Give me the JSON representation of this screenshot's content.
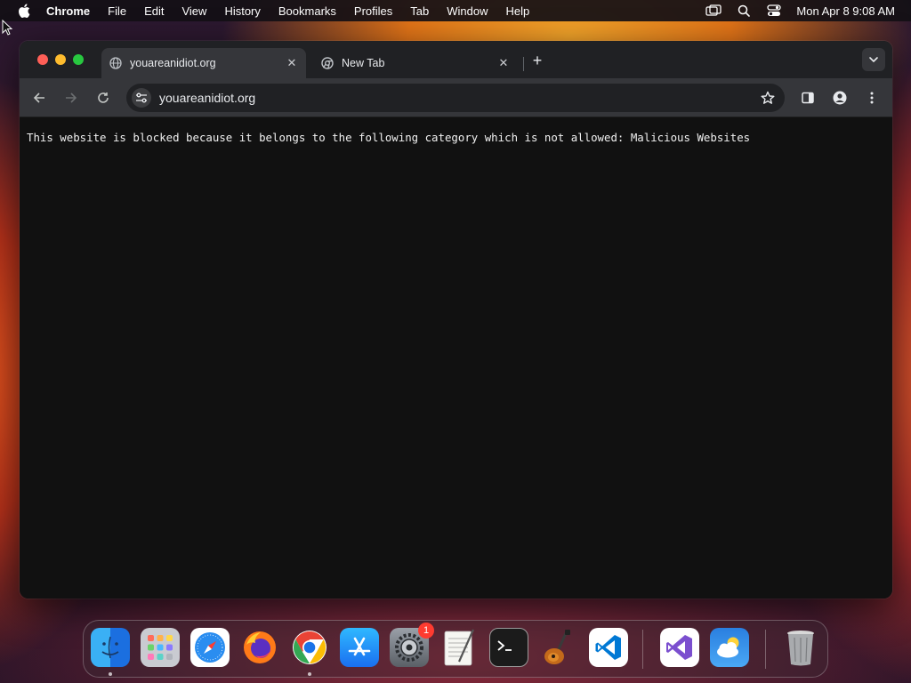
{
  "menubar": {
    "app_name": "Chrome",
    "items": [
      "File",
      "Edit",
      "View",
      "History",
      "Bookmarks",
      "Profiles",
      "Tab",
      "Window",
      "Help"
    ],
    "clock": "Mon Apr 8  9:08 AM",
    "status_icons": [
      "screen-mirroring-icon",
      "spotlight-search-icon",
      "control-center-icon"
    ]
  },
  "browser": {
    "tabs": [
      {
        "title": "youareanidiot.org",
        "favicon": "globe-icon",
        "active": true
      },
      {
        "title": "New Tab",
        "favicon": "chrome-icon",
        "active": false
      }
    ],
    "url": "youareanidiot.org",
    "content_message": "This website is blocked because it belongs to the following category which is not allowed: Malicious Websites"
  },
  "dock": {
    "apps": [
      {
        "name": "Finder",
        "icon": "finder-icon",
        "running": true
      },
      {
        "name": "Launchpad",
        "icon": "launchpad-icon",
        "running": false
      },
      {
        "name": "Safari",
        "icon": "safari-icon",
        "running": false
      },
      {
        "name": "Firefox",
        "icon": "firefox-icon",
        "running": false
      },
      {
        "name": "Google Chrome",
        "icon": "chrome-icon",
        "running": true
      },
      {
        "name": "App Store",
        "icon": "app-store-icon",
        "running": false
      },
      {
        "name": "System Settings",
        "icon": "system-settings-icon",
        "running": false,
        "badge": "1"
      },
      {
        "name": "TextEdit",
        "icon": "textedit-icon",
        "running": false
      },
      {
        "name": "Terminal",
        "icon": "terminal-icon",
        "running": false
      },
      {
        "name": "GarageBand",
        "icon": "garageband-icon",
        "running": false
      },
      {
        "name": "Visual Studio Code",
        "icon": "vscode-icon",
        "running": false
      },
      {
        "name": "Visual Studio",
        "icon": "visual-studio-icon",
        "running": false
      },
      {
        "name": "Weather",
        "icon": "weather-icon",
        "running": false
      },
      {
        "name": "Trash",
        "icon": "trash-icon",
        "running": false
      }
    ]
  },
  "colors": {
    "menubar_bg": "#141016",
    "tabbar_bg": "#202124",
    "toolbar_bg": "#35363a",
    "content_bg": "#111111",
    "close_red": "#ff5f57",
    "minimize_yellow": "#febc2e",
    "zoom_green": "#28c840"
  }
}
